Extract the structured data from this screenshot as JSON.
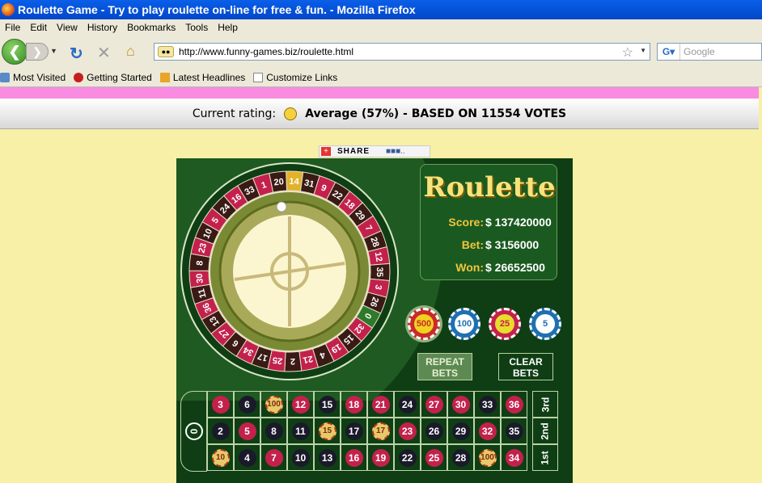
{
  "window": {
    "title": "Roulette Game - Try to play roulette on-line for free & fun. - Mozilla Firefox"
  },
  "menu": [
    "File",
    "Edit",
    "View",
    "History",
    "Bookmarks",
    "Tools",
    "Help"
  ],
  "nav": {
    "url": "http://www.funny-games.biz/roulette.html",
    "search_placeholder": "Google"
  },
  "bookmarks": [
    "Most Visited",
    "Getting Started",
    "Latest Headlines",
    "Customize Links"
  ],
  "rating": {
    "label": "Current rating:",
    "value": "Average (57%) - BASED ON 11554 VOTES"
  },
  "share": {
    "label": "SHARE"
  },
  "game": {
    "title": "Roulette",
    "score_label": "Score:",
    "score_value": "$ 137420000",
    "bet_label": "Bet:",
    "bet_value": "$ 3156000",
    "won_label": "Won:",
    "won_value": "$ 26652500",
    "chips": [
      {
        "value": "500",
        "color": "#f0d21e",
        "ring": "#c92a2a"
      },
      {
        "value": "100",
        "color": "#ffffff",
        "ring": "#1f6fb0"
      },
      {
        "value": "25",
        "color": "#e8dc2c",
        "ring": "#c3214c"
      },
      {
        "value": "5",
        "color": "#ffffff",
        "ring": "#1f6fb0"
      }
    ],
    "repeat_label_1": "REPEAT",
    "repeat_label_2": "BETS",
    "clear_label_1": "CLEAR",
    "clear_label_2": "BETS",
    "zero": "0",
    "wheel_numbers": [
      "14",
      "31",
      "9",
      "22",
      "18",
      "29",
      "7",
      "28",
      "12",
      "35",
      "3",
      "26",
      "0",
      "32",
      "15",
      "19",
      "4",
      "21",
      "2",
      "25",
      "17",
      "34",
      "6",
      "27",
      "13",
      "36",
      "11",
      "30",
      "8",
      "23",
      "10",
      "5",
      "24",
      "16",
      "33",
      "1",
      "20"
    ],
    "rows": [
      [
        {
          "n": "3",
          "c": "red"
        },
        {
          "n": "6",
          "c": "black"
        },
        {
          "n": "100",
          "c": "chip"
        },
        {
          "n": "12",
          "c": "red"
        },
        {
          "n": "15",
          "c": "black"
        },
        {
          "n": "18",
          "c": "red"
        },
        {
          "n": "21",
          "c": "red"
        },
        {
          "n": "24",
          "c": "black"
        },
        {
          "n": "27",
          "c": "red"
        },
        {
          "n": "30",
          "c": "red"
        },
        {
          "n": "33",
          "c": "black"
        },
        {
          "n": "36",
          "c": "red"
        }
      ],
      [
        {
          "n": "2",
          "c": "black"
        },
        {
          "n": "5",
          "c": "red"
        },
        {
          "n": "8",
          "c": "black"
        },
        {
          "n": "11",
          "c": "black"
        },
        {
          "n": "15",
          "c": "chip"
        },
        {
          "n": "17",
          "c": "black"
        },
        {
          "n": "17",
          "c": "chip"
        },
        {
          "n": "23",
          "c": "red"
        },
        {
          "n": "26",
          "c": "black"
        },
        {
          "n": "29",
          "c": "black"
        },
        {
          "n": "32",
          "c": "red"
        },
        {
          "n": "35",
          "c": "black"
        }
      ],
      [
        {
          "n": "10",
          "c": "chip"
        },
        {
          "n": "4",
          "c": "black"
        },
        {
          "n": "7",
          "c": "red"
        },
        {
          "n": "10",
          "c": "black"
        },
        {
          "n": "13",
          "c": "black"
        },
        {
          "n": "16",
          "c": "red"
        },
        {
          "n": "19",
          "c": "red"
        },
        {
          "n": "22",
          "c": "black"
        },
        {
          "n": "25",
          "c": "red"
        },
        {
          "n": "28",
          "c": "black"
        },
        {
          "n": "100",
          "c": "chip"
        },
        {
          "n": "34",
          "c": "red"
        }
      ]
    ],
    "columns": [
      "3rd",
      "2nd",
      "1st"
    ]
  },
  "colors": {
    "felt": "#0f3e14",
    "red": "#c3214c",
    "black": "#1a1a2a",
    "gold": "#f2c43e"
  }
}
